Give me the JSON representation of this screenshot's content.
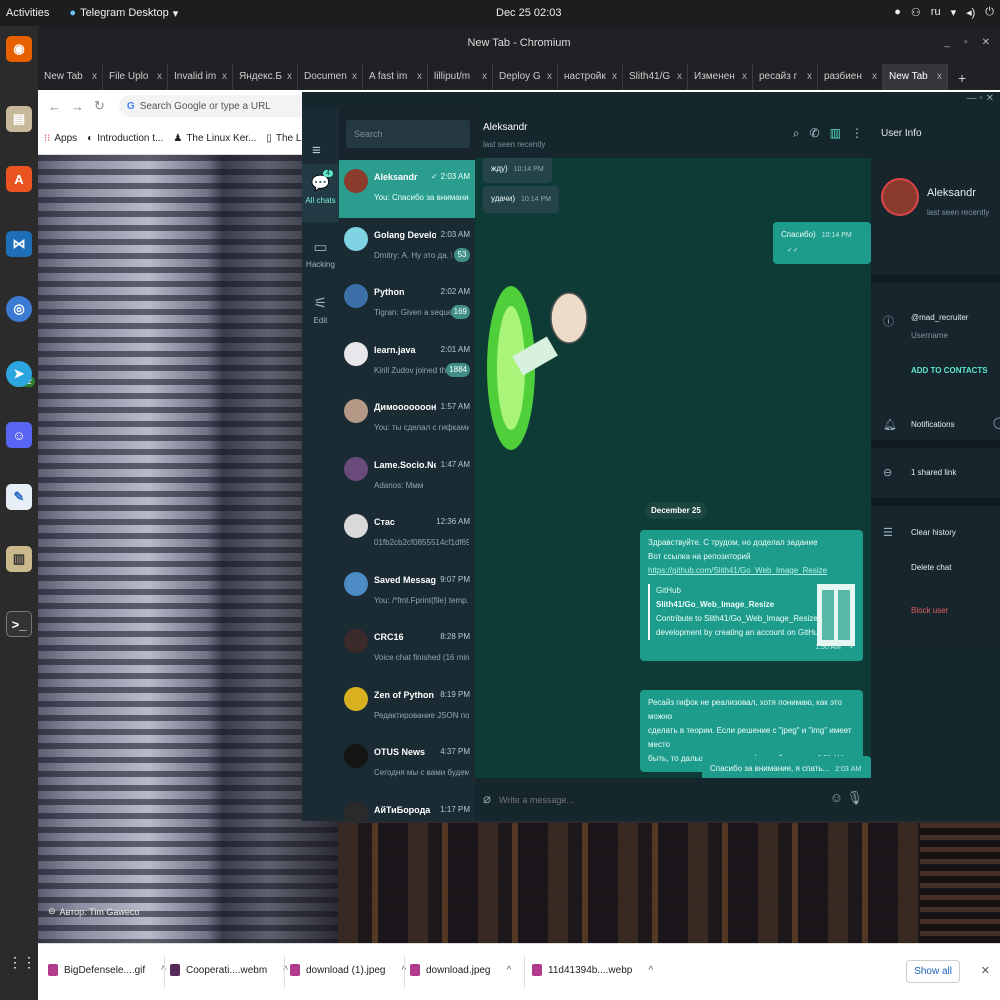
{
  "topbar": {
    "activities": "Activities",
    "app_name": "Telegram Desktop",
    "clock": "Dec 25  02:03",
    "lang": "ru"
  },
  "dock": {
    "telegram_badge": "3302",
    "items": [
      "firefox-icon",
      "files-icon",
      "software-icon",
      "vscode-icon",
      "chromium-icon",
      "telegram-icon",
      "discord-icon",
      "text-editor-icon",
      "archive-icon",
      "terminal-icon"
    ]
  },
  "chrome": {
    "window_title": "New Tab - Chromium",
    "tabs": [
      {
        "label": "New Tab"
      },
      {
        "label": "File Uplo"
      },
      {
        "label": "Invalid im"
      },
      {
        "label": "Яндекс.Б"
      },
      {
        "label": "Documen"
      },
      {
        "label": "A fast im"
      },
      {
        "label": "lilliput/m"
      },
      {
        "label": "Deploy G"
      },
      {
        "label": "настройк"
      },
      {
        "label": "Slith41/G"
      },
      {
        "label": "Изменен"
      },
      {
        "label": "ресайз г"
      },
      {
        "label": "разбиен"
      },
      {
        "label": "New Tab"
      }
    ],
    "omnibox_placeholder": "Search Google or type a URL",
    "bookmarks": [
      {
        "label": "Apps"
      },
      {
        "label": "Introduction t..."
      },
      {
        "label": "The Linux Ker..."
      },
      {
        "label": "The Linux Ker..."
      }
    ]
  },
  "wallpaper": {
    "credit": "Автор: Tim Gaweco"
  },
  "telegram": {
    "search_placeholder": "Search",
    "folders": [
      {
        "label": "All chats",
        "badge": "4"
      },
      {
        "label": "Hacking"
      },
      {
        "label": "Edit"
      }
    ],
    "chats": [
      {
        "name": "Aleksandr",
        "time": "2:03 AM",
        "preview": "You: Спасибо за внимание,...",
        "check": "✓",
        "avatar_color": "#8a3b2e"
      },
      {
        "name": "Golang Develo...",
        "time": "2:03 AM",
        "preview": "Dmitry: А. Ну это да. Н...",
        "badge": "53",
        "avatar_color": "#7fd3e3"
      },
      {
        "name": "Python",
        "time": "2:02 AM",
        "preview": "Tigran: Given a seque...",
        "badge": "169",
        "avatar_color": "#3a6fa8"
      },
      {
        "name": "learn.java",
        "time": "2:01 AM",
        "preview": "Kirill Zudov joined the...",
        "badge": "1884",
        "avatar_color": "#e8e8ec"
      },
      {
        "name": "Димооооооон",
        "time": "1:57 AM",
        "preview": "You: ты сделал с гифками?",
        "check": "✓",
        "avatar_color": "#b49a86"
      },
      {
        "name": "Lame.Socio.Net",
        "time": "1:47 AM",
        "preview": "Adanos: Ммм",
        "avatar_color": "#6a4a7a"
      },
      {
        "name": "Стас",
        "time": "12:36 AM",
        "preview": "01fb2cb2cf0855514cf1df69f...",
        "avatar_color": "#d9d9d9"
      },
      {
        "name": "Saved Messages",
        "time": "9:07 PM",
        "preview": "You: /*fmt.Fprint(file)  temp...",
        "avatar_color": "#4d8bc4"
      },
      {
        "name": "CRC16",
        "time": "8:28 PM",
        "preview": "Voice chat finished (16 minu...",
        "avatar_color": "#3a2a2a"
      },
      {
        "name": "Zen of Python",
        "time": "8:19 PM",
        "preview": "Редактирование JSON пол...",
        "avatar_color": "#d8b020"
      },
      {
        "name": "OTUS News",
        "time": "4:37 PM",
        "preview": "Сегодня мы с вами будем з...",
        "avatar_color": "#151515"
      },
      {
        "name": "АйТиБорода",
        "time": "1:17 PM",
        "preview": "",
        "avatar_color": "#2a2a2a"
      }
    ],
    "conversation": {
      "name": "Aleksandr",
      "status": "last seen recently",
      "messages": [
        {
          "dir": "in",
          "text": "жду)",
          "time": "10:14 PM"
        },
        {
          "dir": "in",
          "text": "удачи)",
          "time": "10:14 PM"
        },
        {
          "dir": "out",
          "text": "Спасибо)",
          "time": "10:14 PM",
          "check": "✓✓"
        }
      ],
      "date_separator": "December 25",
      "long_message": {
        "line1": "Здравствуйте. С трудом, но доделал задание",
        "line2": "Вот ссылка на репозиторий",
        "link": "https://github.com/Slith41/Go_Web_Image_Resize",
        "preview_site": "GitHub",
        "preview_title": "Slith41/Go_Web_Image_Resize",
        "preview_desc1": "Contribute to Slith41/Go_Web_Image_Resize",
        "preview_desc2": "development by creating an account on GitHub.",
        "time": "1:50 AM",
        "check": "✓"
      },
      "msg_gif": {
        "line1": "Ресайз гифок не реализовал, хотя понимаю, как это можно",
        "line2": "сделать в теории. Если решение с \"jpeg\" и \"img\" имеет место",
        "line3": "быть, то дальше можно и гифки добавить.",
        "time": "2:01 AM",
        "check": "✓"
      },
      "msg_thanks": {
        "text": "Спасибо за внимание, я спать...",
        "time": "2:03 AM",
        "check": "✓"
      },
      "composer_placeholder": "Write a message..."
    },
    "user_info": {
      "title": "User Info",
      "name": "Aleksandr",
      "status": "last seen recently",
      "username": "@mad_recruiter",
      "username_label": "Username",
      "add_contact": "ADD TO CONTACTS",
      "notifications": "Notifications",
      "shared_links": "1 shared link",
      "clear_history": "Clear history",
      "delete_chat": "Delete chat",
      "block_user": "Block user"
    }
  },
  "downloads": {
    "items": [
      {
        "name": "BigDefensele....gif"
      },
      {
        "name": "Cooperati....webm"
      },
      {
        "name": "download (1).jpeg"
      },
      {
        "name": "download.jpeg"
      },
      {
        "name": "11d41394b....webp"
      }
    ],
    "show_all": "Show all"
  }
}
